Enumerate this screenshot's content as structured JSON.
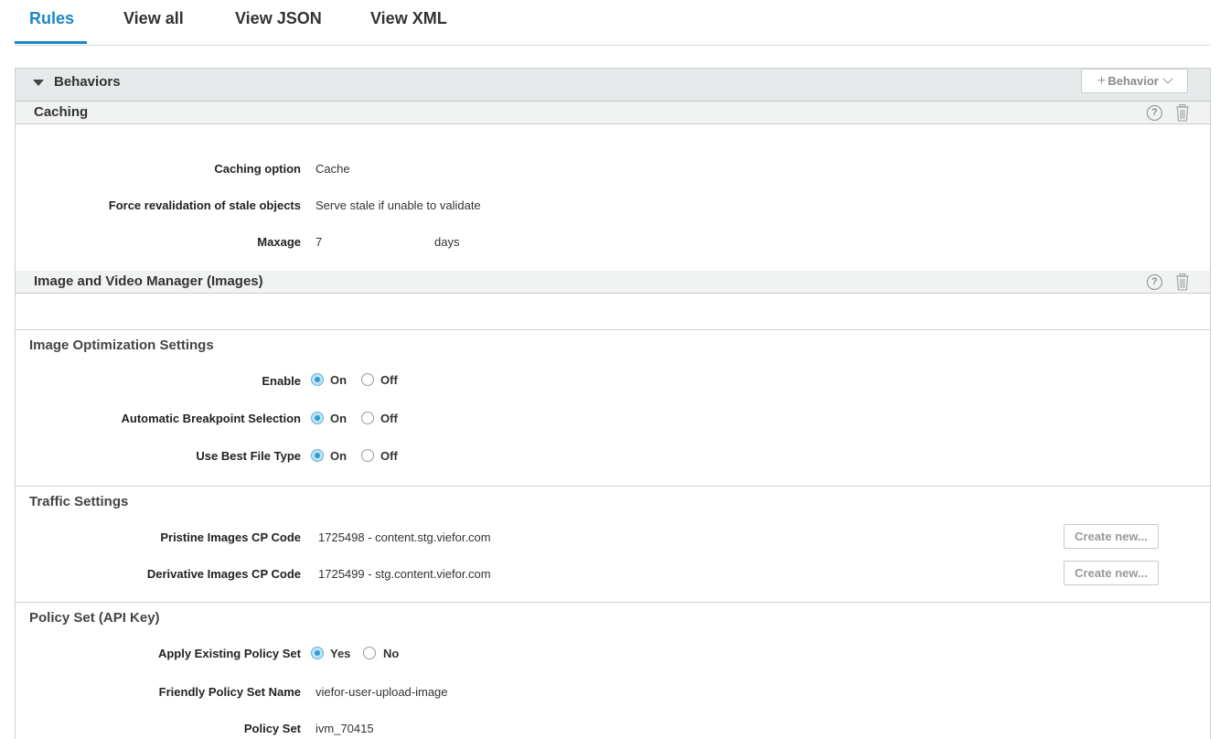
{
  "tabs": [
    {
      "label": "Rules",
      "active": true
    },
    {
      "label": "View all",
      "active": false
    },
    {
      "label": "View JSON",
      "active": false
    },
    {
      "label": "View XML",
      "active": false
    }
  ],
  "behaviors": {
    "title": "Behaviors",
    "add_button_label": "Behavior"
  },
  "caching": {
    "title": "Caching",
    "fields": [
      {
        "label": "Caching option",
        "value": "Cache"
      },
      {
        "label": "Force revalidation of stale objects",
        "value": "Serve stale if unable to validate"
      },
      {
        "label": "Maxage",
        "value": "7",
        "unit": "days"
      }
    ]
  },
  "ivm": {
    "title": "Image and Video Manager (Images)",
    "optimization": {
      "title": "Image Optimization Settings",
      "fields": [
        {
          "label": "Enable",
          "options": [
            "On",
            "Off"
          ],
          "selected": "On"
        },
        {
          "label": "Automatic Breakpoint Selection",
          "options": [
            "On",
            "Off"
          ],
          "selected": "On"
        },
        {
          "label": "Use Best File Type",
          "options": [
            "On",
            "Off"
          ],
          "selected": "On"
        }
      ]
    },
    "traffic": {
      "title": "Traffic Settings",
      "fields": [
        {
          "label": "Pristine Images CP Code",
          "value": "1725498 - content.stg.viefor.com",
          "button": "Create new..."
        },
        {
          "label": "Derivative Images CP Code",
          "value": "1725499 - stg.content.viefor.com",
          "button": "Create new..."
        }
      ]
    },
    "policy": {
      "title": "Policy Set (API Key)",
      "apply": {
        "label": "Apply Existing Policy Set",
        "options": [
          "Yes",
          "No"
        ],
        "selected": "Yes"
      },
      "friendly_name": {
        "label": "Friendly Policy Set Name",
        "value": "viefor-user-upload-image"
      },
      "policy_set": {
        "label": "Policy Set",
        "value": "ivm_70415"
      }
    }
  },
  "icons": {
    "help": "?",
    "colors": {
      "accent": "#1b87c6",
      "radio_selected": "#2f9dd3"
    }
  }
}
